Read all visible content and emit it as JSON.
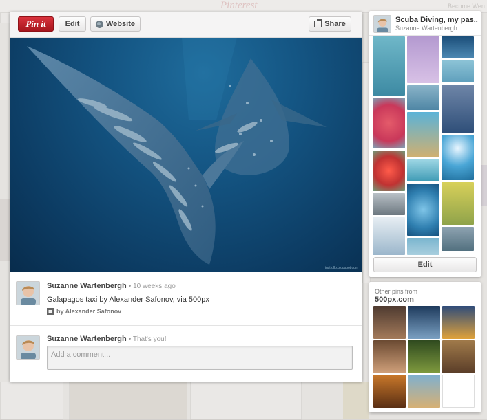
{
  "background_page": {
    "logo": "Pinterest",
    "tab_text": "Become Wen"
  },
  "toolbar": {
    "pin_label": "Pin it",
    "edit_label": "Edit",
    "website_label": "Website",
    "share_label": "Share"
  },
  "photo": {
    "credit": "justfollo.blogspot.com"
  },
  "pin": {
    "user": "Suzanne Wartenbergh",
    "time": "10 weeks ago",
    "description": "Galapagos taxi by Alexander Safonov, via 500px",
    "via": "by Alexander Safonov"
  },
  "comment": {
    "user": "Suzanne Wartenbergh",
    "note": "That's you!",
    "placeholder": "Add a comment..."
  },
  "board": {
    "title": "Scuba Diving, my pas...",
    "owner": "Suzanne Wartenbergh",
    "edit_label": "Edit"
  },
  "other_pins": {
    "label": "Other pins from",
    "source": "500px.com"
  },
  "colors": {
    "pin_red": "#c21b23",
    "ocean_blue": "#145583",
    "panel_bg": "#ffffff"
  },
  "icons": {
    "website": "globe-icon",
    "share": "share-icon",
    "via": "source-icon"
  }
}
